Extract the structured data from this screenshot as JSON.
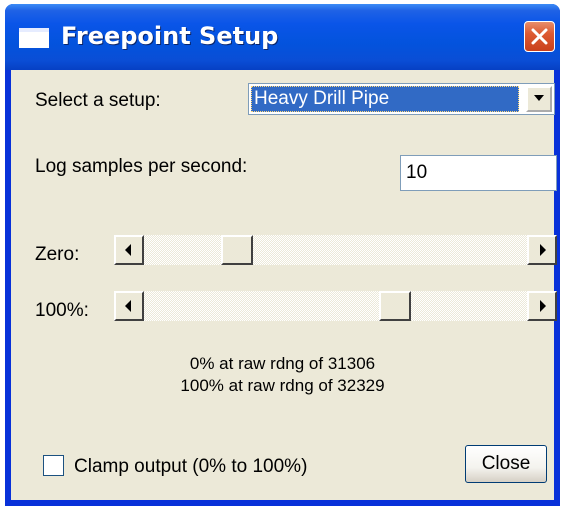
{
  "window": {
    "title": "Freepoint Setup"
  },
  "setup": {
    "label": "Select a setup:",
    "selected": "Heavy Drill Pipe"
  },
  "log_rate": {
    "label": "Log samples per second:",
    "value": "10"
  },
  "sliders": [
    {
      "label": "Zero:",
      "position_fraction": 0.22
    },
    {
      "label": "100%:",
      "position_fraction": 0.67
    }
  ],
  "status": {
    "line1": "0% at raw rdng of 31306",
    "line2": "100% at raw rdng of 32329"
  },
  "clamp": {
    "label": "Clamp output (0% to 100%)",
    "checked": false
  },
  "buttons": {
    "close": "Close"
  }
}
